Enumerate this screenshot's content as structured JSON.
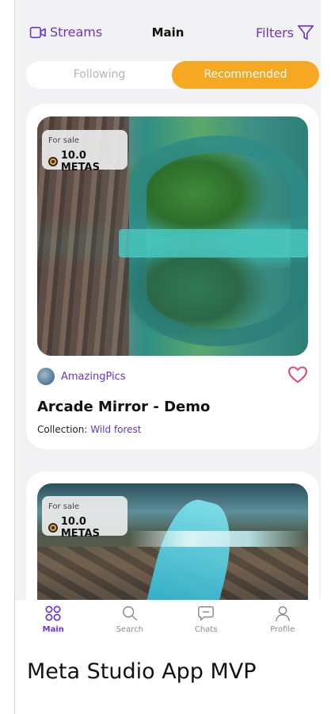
{
  "header": {
    "streams_label": "Streams",
    "title": "Main",
    "filters_label": "Filters"
  },
  "segment": {
    "tabs": [
      "Following",
      "Recommended"
    ],
    "active": "Recommended"
  },
  "cards": [
    {
      "sale_label": "For sale",
      "price": "10.0 METAS",
      "author": "AmazingPics",
      "title": "Arcade Mirror - Demo",
      "collection_prefix": "Collection:",
      "collection_name": "Wild forest"
    },
    {
      "sale_label": "For sale",
      "price": "10.0 METAS"
    }
  ],
  "nav": {
    "items": [
      {
        "label": "Main",
        "icon": "grid-icon",
        "active": true
      },
      {
        "label": "Search",
        "icon": "search-icon",
        "active": false
      },
      {
        "label": "Chats",
        "icon": "chat-icon",
        "active": false
      },
      {
        "label": "Profile",
        "icon": "profile-icon",
        "active": false
      }
    ]
  },
  "caption": "Meta Studio App MVP",
  "colors": {
    "accent": "#6c33c9",
    "orange": "#f6a823",
    "background": "#f2f2f4"
  }
}
